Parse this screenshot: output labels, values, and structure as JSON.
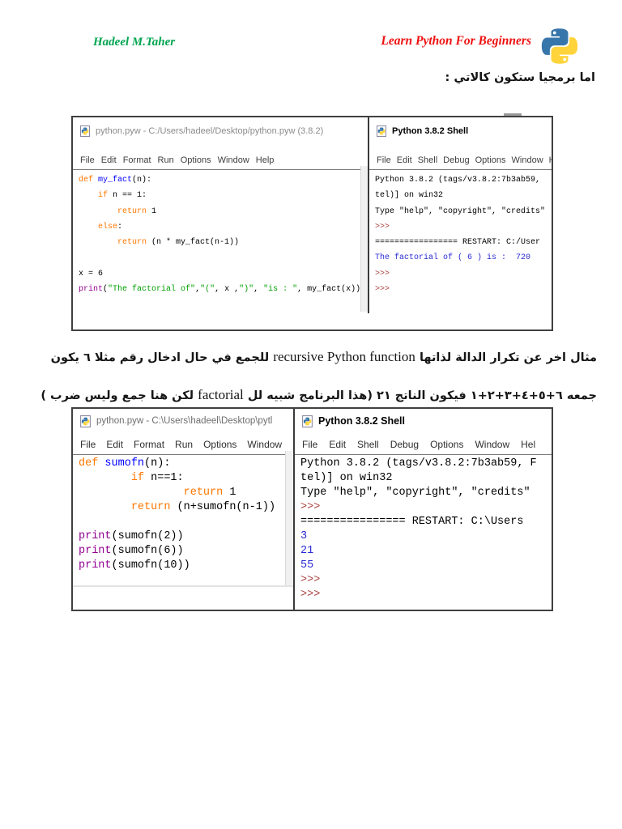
{
  "header": {
    "author": "Hadeel M.Taher",
    "course_title": "Learn Python For Beginners",
    "logo": "python-logo"
  },
  "intro": {
    "text": "اما برمجيا ستكون كالاتي :"
  },
  "paragraph": {
    "line1": {
      "ar_start": "مثال اخر عن تكرار الدالة لذاتها ",
      "en": "recursive Python function",
      "ar_end": " للجمع  في حال ادخال رقم مثلا ٦ يكون"
    },
    "line2": {
      "ar_start": "جمعه ٦+٥+٤+٣+٢+١ فيكون الناتج ٢١ (هذا البرنامج شبيه لل ",
      "en": "factorial",
      "ar_end": " لكن هنا جمع وليس ضرب )"
    }
  },
  "colors": {
    "author_green": "#00A550",
    "course_red": "#EE1111",
    "keyword_orange": "#FF7700",
    "defname_blue": "#0000FF",
    "string_green": "#00A000",
    "builtin_purple": "#900090",
    "shell_output_blue": "#2B2BD5",
    "shell_prompt_red": "#A8423E",
    "python_logo_blue": "#3776AB",
    "python_logo_yellow": "#FFD43B"
  },
  "shot1": {
    "editor": {
      "icon": "python-file-icon",
      "title": "python.pyw - C:/Users/hadeel/Desktop/python.pyw (3.8.2)",
      "menu": [
        "File",
        "Edit",
        "Format",
        "Run",
        "Options",
        "Window",
        "Help"
      ],
      "lines": [
        [
          {
            "c": "kw",
            "t": "def"
          },
          {
            "c": "pl",
            "t": " "
          },
          {
            "c": "fn",
            "t": "my_fact"
          },
          {
            "c": "pl",
            "t": "(n):"
          }
        ],
        [
          {
            "c": "pl",
            "t": "    "
          },
          {
            "c": "kw",
            "t": "if"
          },
          {
            "c": "pl",
            "t": " n == 1:"
          }
        ],
        [
          {
            "c": "pl",
            "t": "        "
          },
          {
            "c": "kw",
            "t": "return"
          },
          {
            "c": "pl",
            "t": " 1"
          }
        ],
        [
          {
            "c": "pl",
            "t": "    "
          },
          {
            "c": "kw",
            "t": "else"
          },
          {
            "c": "pl",
            "t": ":"
          }
        ],
        [
          {
            "c": "pl",
            "t": "        "
          },
          {
            "c": "kw",
            "t": "return"
          },
          {
            "c": "pl",
            "t": " (n * my_fact(n-1))"
          }
        ],
        [],
        [
          {
            "c": "pl",
            "t": "x = 6"
          }
        ],
        [
          {
            "c": "bi",
            "t": "print"
          },
          {
            "c": "pl",
            "t": "("
          },
          {
            "c": "str",
            "t": "\"The factorial of\""
          },
          {
            "c": "pl",
            "t": ","
          },
          {
            "c": "str",
            "t": "\"(\""
          },
          {
            "c": "pl",
            "t": ", x ,"
          },
          {
            "c": "str",
            "t": "\")\""
          },
          {
            "c": "pl",
            "t": ", "
          },
          {
            "c": "str",
            "t": "\"is : \""
          },
          {
            "c": "pl",
            "t": ", my_fact(x))"
          }
        ]
      ]
    },
    "shell": {
      "icon": "python-shell-icon",
      "title": "Python 3.8.2 Shell",
      "menu": [
        "File",
        "Edit",
        "Shell",
        "Debug",
        "Options",
        "Window",
        "H"
      ],
      "lines": [
        [
          {
            "c": "txt",
            "t": "Python 3.8.2 (tags/v3.8.2:7b3ab59,"
          }
        ],
        [
          {
            "c": "txt",
            "t": "tel)] on win32"
          }
        ],
        [
          {
            "c": "txt",
            "t": "Type \"help\", \"copyright\", \"credits\""
          }
        ],
        [
          {
            "c": "prm",
            "t": ">>>"
          }
        ],
        [
          {
            "c": "txt",
            "t": "================= RESTART: C:/User"
          }
        ],
        [
          {
            "c": "out",
            "t": "The factorial of ( 6 ) is :  720"
          }
        ],
        [
          {
            "c": "prm",
            "t": ">>>"
          }
        ],
        [
          {
            "c": "prm",
            "t": ">>>"
          }
        ]
      ]
    }
  },
  "shot2": {
    "editor": {
      "icon": "python-file-icon",
      "title": "python.pyw - C:\\Users\\hadeel\\Desktop\\pytl",
      "menu": [
        "File",
        "Edit",
        "Format",
        "Run",
        "Options",
        "Window"
      ],
      "lines": [
        [
          {
            "c": "kw",
            "t": "def"
          },
          {
            "c": "pl",
            "t": " "
          },
          {
            "c": "fn",
            "t": "sumofn"
          },
          {
            "c": "pl",
            "t": "(n):"
          }
        ],
        [
          {
            "c": "pl",
            "t": "        "
          },
          {
            "c": "kw",
            "t": "if"
          },
          {
            "c": "pl",
            "t": " n==1:"
          }
        ],
        [
          {
            "c": "pl",
            "t": "                "
          },
          {
            "c": "kw",
            "t": "return"
          },
          {
            "c": "pl",
            "t": " 1"
          }
        ],
        [
          {
            "c": "pl",
            "t": "        "
          },
          {
            "c": "kw",
            "t": "return"
          },
          {
            "c": "pl",
            "t": " (n+sumofn(n-1))"
          }
        ],
        [],
        [
          {
            "c": "bi",
            "t": "print"
          },
          {
            "c": "pl",
            "t": "(sumofn(2))"
          }
        ],
        [
          {
            "c": "bi",
            "t": "print"
          },
          {
            "c": "pl",
            "t": "(sumofn(6))"
          }
        ],
        [
          {
            "c": "bi",
            "t": "print"
          },
          {
            "c": "pl",
            "t": "(sumofn(10))"
          }
        ]
      ]
    },
    "shell": {
      "icon": "python-shell-icon",
      "title": "Python 3.8.2 Shell",
      "menu": [
        "File",
        "Edit",
        "Shell",
        "Debug",
        "Options",
        "Window",
        "Hel"
      ],
      "lines": [
        [
          {
            "c": "txt",
            "t": "Python 3.8.2 (tags/v3.8.2:7b3ab59, F"
          }
        ],
        [
          {
            "c": "txt",
            "t": "tel)] on win32"
          }
        ],
        [
          {
            "c": "txt",
            "t": "Type \"help\", \"copyright\", \"credits\""
          }
        ],
        [
          {
            "c": "prm",
            "t": ">>>"
          }
        ],
        [
          {
            "c": "txt",
            "t": "================ RESTART: C:\\Users"
          }
        ],
        [
          {
            "c": "out",
            "t": "3"
          }
        ],
        [
          {
            "c": "out",
            "t": "21"
          }
        ],
        [
          {
            "c": "out",
            "t": "55"
          }
        ],
        [
          {
            "c": "prm",
            "t": ">>>"
          }
        ],
        [
          {
            "c": "prm",
            "t": ">>>"
          }
        ]
      ]
    }
  }
}
